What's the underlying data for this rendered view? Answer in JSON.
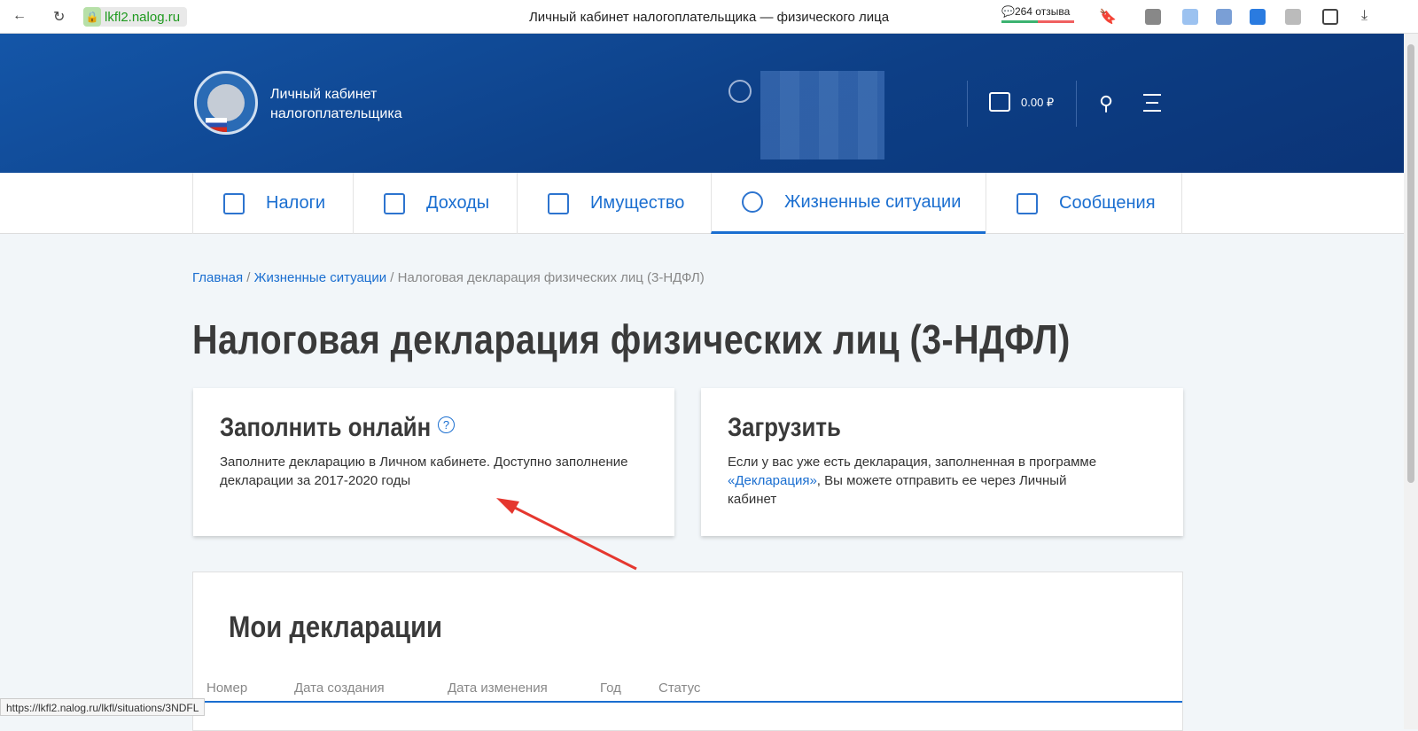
{
  "browser": {
    "url": "lkfl2.nalog.ru",
    "title": "Личный кабинет налогоплательщика — физического лица",
    "reviews": "264 отзыва",
    "status_url": "https://lkfl2.nalog.ru/lkfl/situations/3NDFL"
  },
  "header": {
    "brand": "Личный кабинет налогоплательщика",
    "balance": "0.00 ₽"
  },
  "nav": [
    {
      "label": "Налоги"
    },
    {
      "label": "Доходы"
    },
    {
      "label": "Имущество"
    },
    {
      "label": "Жизненные ситуации"
    },
    {
      "label": "Сообщения"
    }
  ],
  "breadcrumb": {
    "home": "Главная",
    "section": "Жизненные ситуации",
    "current": "Налоговая декларация физических лиц (3-НДФЛ)"
  },
  "page_title": "Налоговая декларация физических лиц (3-НДФЛ)",
  "cards": {
    "online": {
      "title": "Заполнить онлайн",
      "text": "Заполните декларацию в Личном кабинете. Доступно заполнение декларации за 2017-2020 годы"
    },
    "upload": {
      "title": "Загрузить",
      "text1": "Если у вас уже есть декларация, заполненная в программе ",
      "link": "«Декларация»",
      "text2": ", Вы можете отправить ее через Личный кабинет"
    }
  },
  "declarations": {
    "title": "Мои декларации",
    "columns": [
      "Номер",
      "Дата создания",
      "Дата изменения",
      "Год",
      "Статус"
    ]
  }
}
